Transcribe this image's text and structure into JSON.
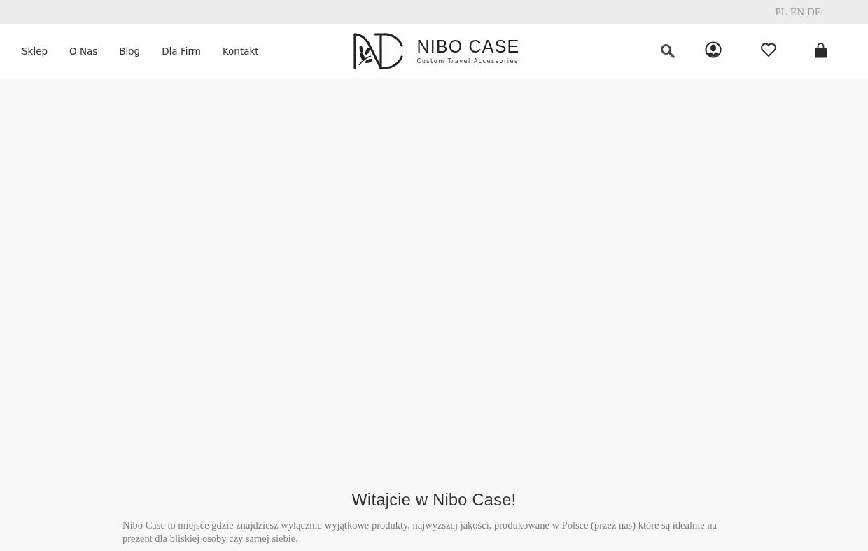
{
  "top_bar": {
    "languages": [
      {
        "label": "PL"
      },
      {
        "label": "EN"
      },
      {
        "label": "DE"
      }
    ]
  },
  "header": {
    "nav": [
      {
        "label": "Sklep"
      },
      {
        "label": "O Nas"
      },
      {
        "label": "Blog"
      },
      {
        "label": "Dla Firm"
      },
      {
        "label": "Kontakt"
      }
    ],
    "logo": {
      "name": "NIBO CASE",
      "tagline": "Custom Travel Accessories"
    }
  },
  "welcome": {
    "heading": "Witajcie w Nibo Case!",
    "text": "Nibo Case to miejsce gdzie znajdziesz wyłącznie wyjątkowe produkty, najwyższej jakości, produkowane w Polsce (przez nas) które są idealnie na prezent dla bliskiej osoby czy samej siebie."
  }
}
